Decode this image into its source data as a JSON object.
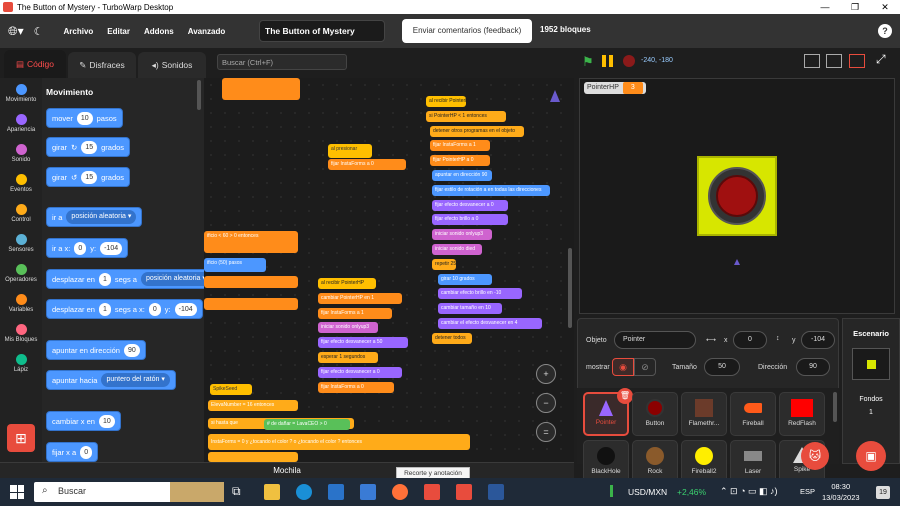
{
  "window": {
    "title": "The Button of Mystery - TurboWarp Desktop"
  },
  "menu": {
    "archivo": "Archivo",
    "editar": "Editar",
    "addons": "Addons",
    "avanzado": "Avanzado",
    "project_title": "The Button of Mystery",
    "feedback": "Enviar comentarios (feedback)",
    "block_count": "1952 bloques"
  },
  "tabs": {
    "code": "Código",
    "costumes": "Disfraces",
    "sounds": "Sonidos"
  },
  "search": {
    "placeholder": "Buscar (Ctrl+F)"
  },
  "categories": [
    {
      "label": "Movimiento",
      "color": "#4c97ff"
    },
    {
      "label": "Apariencia",
      "color": "#9966ff"
    },
    {
      "label": "Sonido",
      "color": "#cf63cf"
    },
    {
      "label": "Eventos",
      "color": "#ffbf00"
    },
    {
      "label": "Control",
      "color": "#ffab19"
    },
    {
      "label": "Sensores",
      "color": "#5cb1d6"
    },
    {
      "label": "Operadores",
      "color": "#59c059"
    },
    {
      "label": "Variables",
      "color": "#ff8c1a"
    },
    {
      "label": "Mis Bloques",
      "color": "#ff6680"
    },
    {
      "label": "Lápiz",
      "color": "#0fbd8c"
    }
  ],
  "palette": {
    "heading": "Movimiento",
    "move": "mover",
    "move_val": "10",
    "move_unit": "pasos",
    "turn": "girar",
    "turn_r_val": "15",
    "turn_l_val": "15",
    "deg": "grados",
    "goto": "ir a",
    "goto_dd": "posición aleatoria",
    "goxy": "ir a x:",
    "goxy_x": "0",
    "y": "y:",
    "goxy_y": "-104",
    "glide": "desplazar en",
    "glide_v": "1",
    "glide_mid": "segs a",
    "glide_dd": "posición aleatoria",
    "glide2_mid": "segs a x:",
    "glide2_x": "0",
    "glide2_y": "-104",
    "point": "apuntar en dirección",
    "point_v": "90",
    "pointto": "apuntar hacia",
    "pointto_dd": "puntero del ratón",
    "changex": "cambiar x en",
    "changex_v": "10",
    "setx": "fijar x a",
    "setx_v": "0"
  },
  "workspace": {
    "s1": [
      "al recibir PointerHP",
      "si PointerHP < 1 entonces",
      "detener otros programas en el objeto",
      "fijar InstaForms a 1",
      "fijar PointerHP a 0",
      "apuntar en dirección 90",
      "fijar estilo de rotación a en todas las direcciones",
      "fijar efecto desvanecer a 0",
      "fijar efecto brillo a 0",
      "iniciar sonido onlyup3",
      "iniciar sonido died",
      "repetir 25",
      "girar 10 grados",
      "cambiar efecto brillo en -10",
      "cambiar tamaño en 10",
      "cambiar el efecto desvanecer en 4",
      "detener todos"
    ],
    "s2": [
      "al presionar",
      "fijar InstaForms a 0"
    ],
    "s3": [
      "al recibir PointerHP",
      "cambiar PointerHP en 1",
      "fijar InstaForms a 1",
      "iniciar sonido onlyup3",
      "fijar efecto desvanecer a 50",
      "esperar 1 segundos",
      "fijar efecto desvanecer a 0",
      "fijar InstaForms a 0"
    ],
    "s4": [
      "SpikeSeed",
      "ElevaNumber = 16 entonces",
      "si hasta que",
      "# de dañar = LavaCEO > 0",
      "InstaForms = 0 y ¿tocando el color ? o ¿tocando el color ? entonces"
    ],
    "mid": [
      "ificio",
      "< 60 > 0 entonces",
      "ificio",
      "(50) pasos"
    ]
  },
  "zoom": {
    "in": "+",
    "out": "−",
    "reset": "="
  },
  "stage": {
    "coords": "-240, -180",
    "var_name": "PointerHP",
    "var_value": "3"
  },
  "sprite": {
    "label": "Objeto",
    "name": "Pointer",
    "x_label": "x",
    "x": "0",
    "y_label": "y",
    "y": "-104",
    "show": "mostrar",
    "size_label": "Tamaño",
    "size": "50",
    "dir_label": "Dirección",
    "dir": "90"
  },
  "sprites": [
    {
      "name": "Pointer",
      "color": "#9966ff"
    },
    {
      "name": "Button",
      "color": "#8b0000"
    },
    {
      "name": "Flamethr...",
      "color": "#6b3b2a"
    },
    {
      "name": "Fireball",
      "color": "#ff5a1a"
    },
    {
      "name": "RedFlash",
      "color": "#ff0000"
    },
    {
      "name": "BlackHole",
      "color": "#111111"
    },
    {
      "name": "Rock",
      "color": "#8a5a2b"
    },
    {
      "name": "Fireball2",
      "color": "#ffee00"
    },
    {
      "name": "Laser",
      "color": "#888888"
    },
    {
      "name": "Spike",
      "color": "#dddddd"
    }
  ],
  "scenario": {
    "title": "Escenario",
    "backdrops_label": "Fondos",
    "backdrops": "1"
  },
  "backpack": "Mochila",
  "tooltip": "Recorte y anotación",
  "taskbar": {
    "search": "Buscar",
    "currency": "USD/MXN",
    "change": "+2,46%",
    "lang": "ESP",
    "time": "08:30",
    "date": "13/03/2023",
    "notif": "19"
  }
}
